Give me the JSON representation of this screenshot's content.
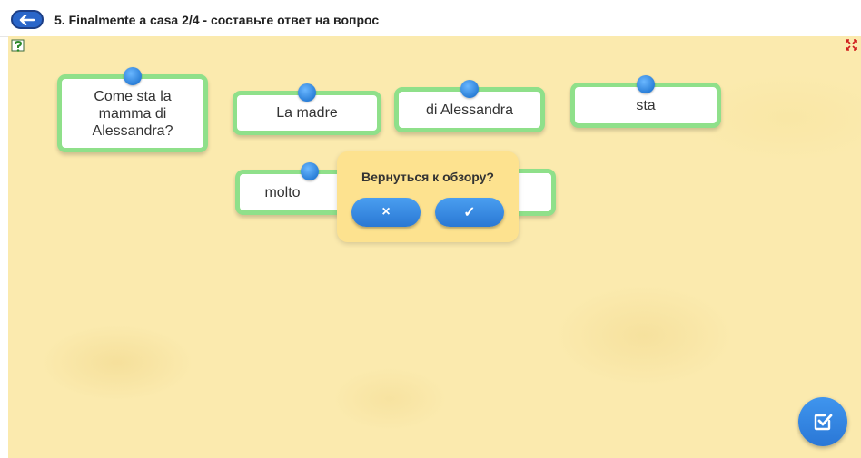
{
  "header": {
    "title": "5. Finalmente a casa 2/4 - составьте ответ на вопрос"
  },
  "cards": [
    {
      "text": "Come sta la mamma di Alessandra?"
    },
    {
      "text": "La madre"
    },
    {
      "text": "di Alessandra"
    },
    {
      "text": "sta"
    },
    {
      "text": "molto"
    },
    {
      "text": ""
    }
  ],
  "dialog": {
    "title": "Вернуться к обзору?",
    "cancel_label": "×",
    "confirm_label": "✓"
  },
  "colors": {
    "background": "#fbeaae",
    "card_border": "#8fe08a",
    "button_blue": "#2a78d4",
    "dialog": "#fde28f"
  }
}
